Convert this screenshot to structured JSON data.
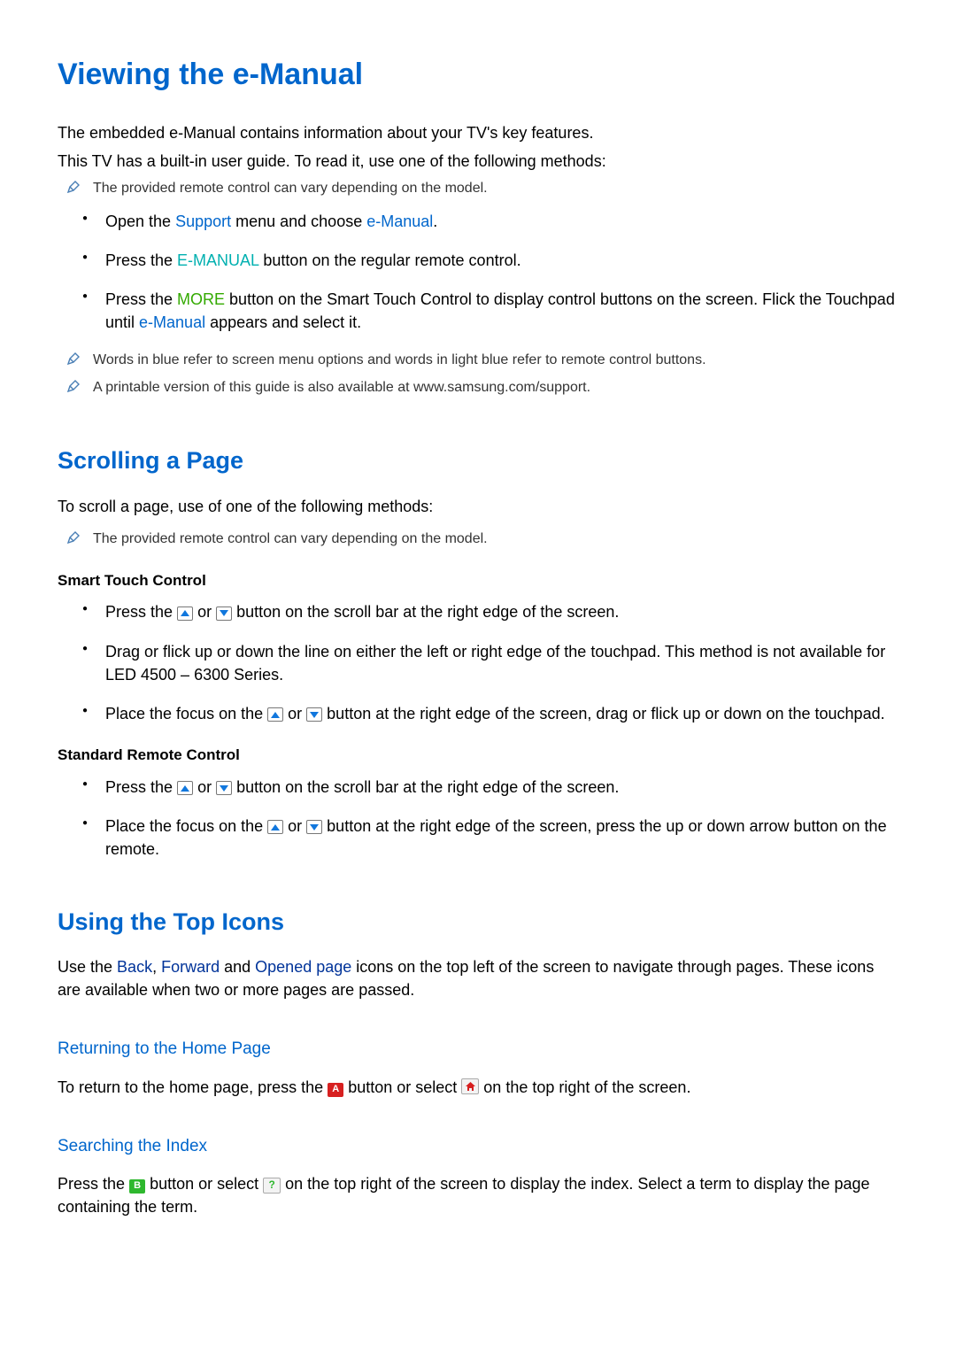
{
  "sections": {
    "viewing": {
      "title": "Viewing the e-Manual",
      "intro1": "The embedded e-Manual contains information about your TV's key features.",
      "intro2": "This TV has a built-in user guide. To read it, use one of the following methods:",
      "note_remote_vary": "The provided remote control can vary depending on the model.",
      "bullets": {
        "b1": {
          "pre": "Open the ",
          "kw1": "Support",
          "mid": " menu and choose ",
          "kw2": "e-Manual",
          "post": "."
        },
        "b2": {
          "pre": "Press the ",
          "kw": "E-MANUAL",
          "post": " button on the regular remote control."
        },
        "b3": {
          "pre": "Press the ",
          "kw": "MORE",
          "mid": " button on the Smart Touch Control to display control buttons on the screen. Flick the Touchpad until ",
          "kw2": "e-Manual",
          "post": " appears and select it."
        }
      },
      "note_colors": "Words in blue refer to screen menu options and words in light blue refer to remote control buttons.",
      "note_print": "A printable version of this guide is also available at www.samsung.com/support."
    },
    "scrolling": {
      "title": "Scrolling a Page",
      "intro": "To scroll a page, use of one of the following methods:",
      "note_remote_vary": "The provided remote control can vary depending on the model.",
      "smart_head": "Smart Touch Control",
      "smart": {
        "s1": {
          "pre": "Press the ",
          "mid": " or ",
          "post": " button on the scroll bar at the right edge of the screen."
        },
        "s2": "Drag or flick up or down the line on either the left or right edge of the touchpad. This method is not available for LED 4500 – 6300 Series.",
        "s3": {
          "pre": "Place the focus on the ",
          "mid": " or ",
          "post": " button at the right edge of the screen, drag or flick up or down on the touchpad."
        }
      },
      "std_head": "Standard Remote Control",
      "std": {
        "r1": {
          "pre": "Press the ",
          "mid": " or ",
          "post": " button on the scroll bar at the right edge of the screen."
        },
        "r2": {
          "pre": "Place the focus on the ",
          "mid": " or ",
          "post": " button at the right edge of the screen, press the up or down arrow button on the remote."
        }
      }
    },
    "icons": {
      "title": "Using the Top Icons",
      "body": {
        "pre": "Use the ",
        "kw1": "Back",
        "sep1": ", ",
        "kw2": "Forward",
        "sep2": " and ",
        "kw3": "Opened page",
        "post": " icons on the top left of the screen to navigate through pages. These icons are available when two or more pages are passed."
      },
      "returning": {
        "title": "Returning to the Home Page",
        "pre": "To return to the home page, press the ",
        "a_label": "A",
        "mid": " button or select ",
        "post": " on the top right of the screen."
      },
      "searching": {
        "title": "Searching the Index",
        "pre": "Press the ",
        "b_label": "B",
        "mid": " button or select ",
        "idx_label": "?",
        "post": " on the top right of the screen to display the index. Select a term to display the page containing the term."
      }
    }
  }
}
